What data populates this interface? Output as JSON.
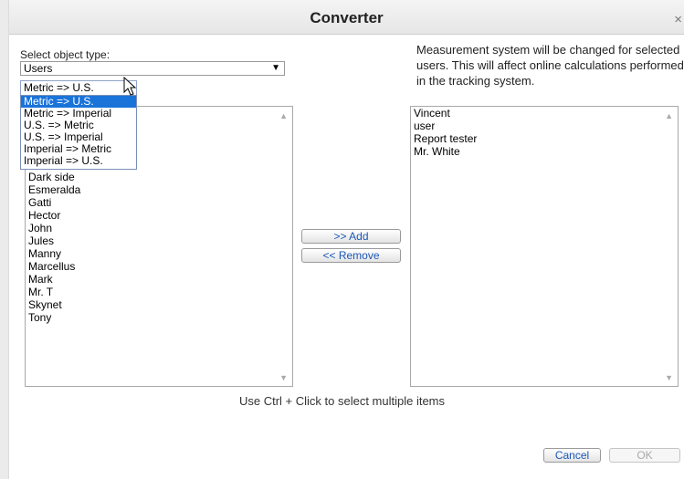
{
  "dialog": {
    "title": "Converter",
    "close_icon": "close-icon",
    "close_symbol": "×"
  },
  "object_type": {
    "label": "Select object type:",
    "value": "Users",
    "arrow": "▼"
  },
  "info_text": "Measurement system will be changed for selected users. This will affect online calculations performed in the tracking system.",
  "conversion": {
    "value": "Metric => U.S.",
    "arrow": "▼",
    "options": [
      "Metric => U.S.",
      "Metric => Imperial",
      "U.S. => Metric",
      "U.S. => Imperial",
      "Imperial => Metric",
      "Imperial => U.S."
    ],
    "selected_index": 0
  },
  "available_users": [
    "Dark side",
    "Esmeralda",
    "Gatti",
    "Hector",
    "John",
    "Jules",
    "Manny",
    "Marcellus",
    "Mark",
    "Mr. T",
    "Skynet",
    "Tony"
  ],
  "selected_users": [
    "Vincent",
    "user",
    "Report tester",
    "Mr. White"
  ],
  "scroll": {
    "up": "▲",
    "down": "▼"
  },
  "buttons": {
    "add": ">> Add",
    "remove": "<< Remove",
    "cancel": "Cancel",
    "ok": "OK"
  },
  "hint": "Use Ctrl + Click to select multiple items",
  "colors": {
    "selection": "#1a73d9",
    "button_text": "#1b58b8",
    "disabled_text": "#a9a9a9"
  }
}
